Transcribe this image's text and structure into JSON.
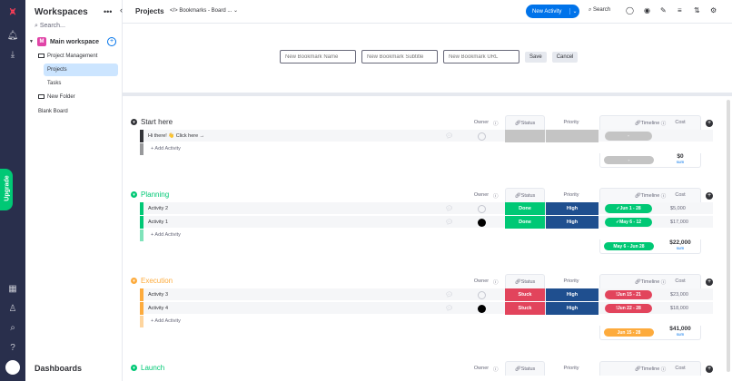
{
  "sidebar": {
    "title": "Workspaces",
    "search_placeholder": "Search...",
    "workspace_badge": "M",
    "workspace_name": "Main workspace",
    "items": [
      {
        "label": "Project Management"
      },
      {
        "label": "Projects"
      },
      {
        "label": "Tasks"
      },
      {
        "label": "New Folder"
      },
      {
        "label": "Blank Board"
      }
    ],
    "footer": "Dashboards"
  },
  "rail": {
    "upgrade_label": "Upgrade"
  },
  "topbar": {
    "title": "Projects",
    "breadcrumb": "</> Bookmarks - Board ...",
    "new_activity": "New Activity",
    "search": "Search"
  },
  "bookmark_form": {
    "name_placeholder": "New Bookmark Name",
    "subtitle_placeholder": "New Bookmark Subtitle",
    "url_placeholder": "New Bookmark URL",
    "save": "Save",
    "cancel": "Cancel"
  },
  "columns": {
    "owner": "Owner",
    "status": "Status",
    "priority": "Priority",
    "timeline": "Timeline",
    "cost": "Cost"
  },
  "add_activity": "+ Add Activity",
  "sum_label": "sum",
  "colors": {
    "start": "#323338",
    "planning": "#00c875",
    "execution": "#fdab3d",
    "launch": "#00c875",
    "done": "#00c875",
    "stuck": "#e2445c",
    "high": "#1f4f8f",
    "timeline_empty": "#c4c4c4"
  },
  "groups": [
    {
      "title": "Start here",
      "rows": [
        {
          "name": "Hi there! 👋 Click here →",
          "status": "",
          "priority": "",
          "timeline": "-",
          "cost": ""
        }
      ],
      "sum_timeline": "-",
      "sum_cost": "$0"
    },
    {
      "title": "Planning",
      "rows": [
        {
          "name": "Activity 2",
          "status": "Done",
          "priority": "High",
          "timeline": "Jun 1 - 28",
          "cost": "$5,000"
        },
        {
          "name": "Activity 1",
          "status": "Done",
          "priority": "High",
          "timeline": "May 6 - 12",
          "cost": "$17,000"
        }
      ],
      "sum_timeline": "May 6 - Jun 28",
      "sum_cost": "$22,000"
    },
    {
      "title": "Execution",
      "rows": [
        {
          "name": "Activity 3",
          "status": "Stuck",
          "priority": "High",
          "timeline": "Jun 15 - 21",
          "cost": "$23,000"
        },
        {
          "name": "Activity 4",
          "status": "Stuck",
          "priority": "High",
          "timeline": "Jun 22 - 28",
          "cost": "$18,000"
        }
      ],
      "sum_timeline": "Jun 15 - 28",
      "sum_cost": "$41,000"
    },
    {
      "title": "Launch",
      "rows": [],
      "sum_timeline": "",
      "sum_cost": ""
    }
  ]
}
